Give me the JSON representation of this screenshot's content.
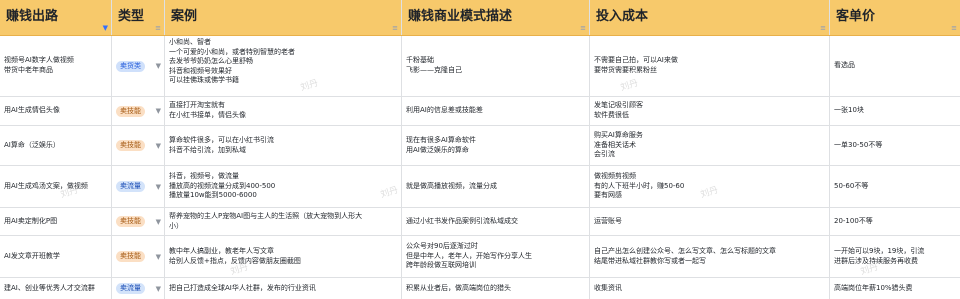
{
  "headers": [
    "赚钱出路",
    "类型",
    "案例",
    "赚钱商业模式描述",
    "投入成本",
    "客单价"
  ],
  "rows": [
    {
      "path": [
        "视频号AI数字人做视频",
        "带货中老年商品"
      ],
      "type": "卖货类",
      "cases": [
        "小和尚、智者",
        "一个可爱的小和尚，或者特别智慧的老者",
        "去发爷爷奶奶怎么心里舒畅",
        "抖音和视频号效果好",
        "可以挂佛珠或佛学书籍"
      ],
      "model": [
        "千粉基础",
        "飞影——克隆自己"
      ],
      "cost": [
        "不需要自己拍，可以AI来做",
        "要带货需要积累粉丝"
      ],
      "price": [
        "看选品"
      ]
    },
    {
      "path": [
        "用AI生成情侣头像"
      ],
      "type": "卖技能",
      "cases": [
        "直接打开淘宝就有",
        "在小红书接单，情侣头像"
      ],
      "model": [
        "利用AI的信息差或技能差"
      ],
      "cost": [
        "发笔记吸引顾客",
        "软件费很低"
      ],
      "price": [
        "一张10块"
      ]
    },
    {
      "path": [
        "AI算命（泛娱乐）"
      ],
      "type": "卖技能",
      "cases": [
        "算命软件很多，可以在小红书引流",
        "抖音不给引流，加到私域"
      ],
      "model": [
        "现在有很多AI算命软件",
        "用AI做泛娱乐的算命"
      ],
      "cost": [
        "购买AI算命服务",
        "准备相关话术",
        "会引流"
      ],
      "price": [
        "一单30-50不等"
      ]
    },
    {
      "path": [
        "用AI生成鸡汤文案，做视频"
      ],
      "type": "卖流量",
      "cases": [
        "抖音，视频号，做流量",
        "播放高的视频流量分成到400-500",
        "播放量10w能到5000-6000"
      ],
      "model": [
        "就是做高播放视频，流量分成"
      ],
      "cost": [
        "做视频剪视频",
        "有的人下班半小时，赚50-60",
        "要有网感"
      ],
      "price": [
        "50-60不等"
      ]
    },
    {
      "path": [
        "用AI卖定制化P图"
      ],
      "type": "卖技能",
      "cases": [
        "帮养宠物的主人P宠物AI图与主人的生活照（放大宠物到人形大",
        "小）"
      ],
      "model": [
        "通过小红书发作品案例引流私域成交"
      ],
      "cost": [
        "运营账号"
      ],
      "price": [
        "20-100不等"
      ]
    },
    {
      "path": [
        "AI发文章开班教学"
      ],
      "type": "卖技能",
      "cases": [
        "教中年人搞副业，教老年人写文章",
        "给别人反馈+指点，反馈内容做朋友圈截图"
      ],
      "model": [
        "公众号对90后逐渐过时",
        "但是中年人，老年人，开始写作分享人生",
        "跨年龄段做互联网培训"
      ],
      "cost": [
        "自己产出怎么创建公众号、怎么写文章、怎么写标题的文章",
        "结尾带进私域社群教你写或者一起写"
      ],
      "price": [
        "一开始可以9块，19块，引流",
        "进群后涉及持续服务再收费"
      ]
    },
    {
      "path": [
        "建AI、创业等优秀人才交流群"
      ],
      "type": "卖流量",
      "cases": [
        "把自己打造成全球AI华人社群，发布的行业资讯"
      ],
      "model": [
        "积累从业者后，做高端岗位的猎头"
      ],
      "cost": [
        "收集资讯"
      ],
      "price": [
        "高端岗位年薪10%猎头费"
      ]
    }
  ],
  "icons": {
    "filter": "filter-icon",
    "dropdown": "chevron-down-icon"
  },
  "watermark": "刘丹"
}
